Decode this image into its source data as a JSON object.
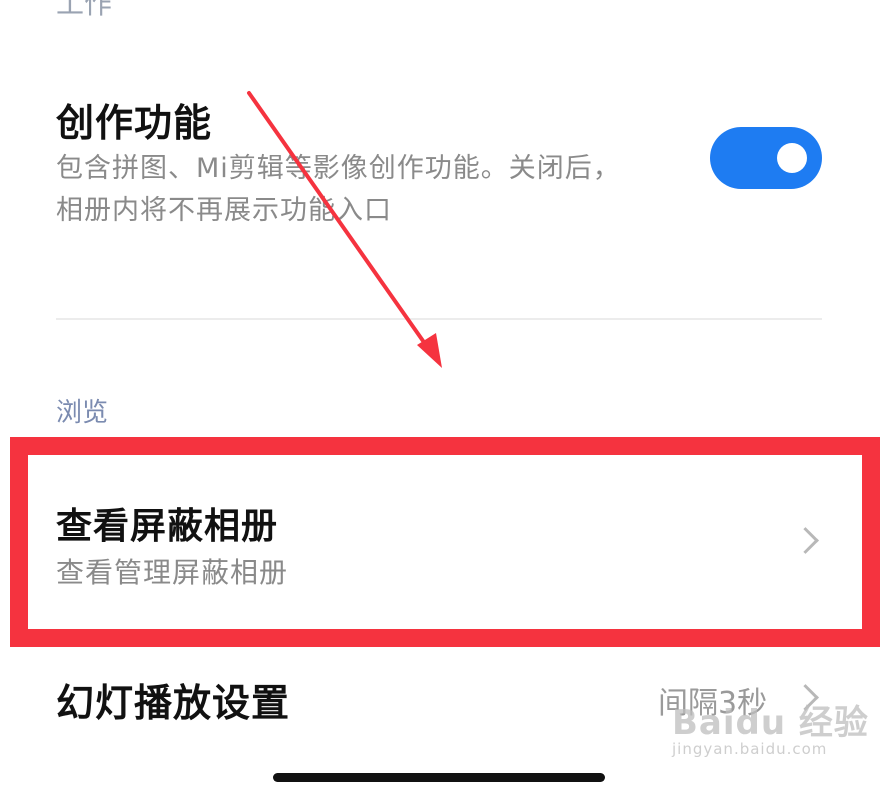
{
  "top_clipped_text": "工作",
  "creative": {
    "title": "创作功能",
    "desc_line1": "包含拼图、Mi剪辑等影像创作功能。关闭后，",
    "desc_line2": "相册内将不再展示功能入口",
    "toggle_on": true
  },
  "browse_section": {
    "header": "浏览"
  },
  "hidden_album": {
    "title": "查看屏蔽相册",
    "subtitle": "查看管理屏蔽相册"
  },
  "slideshow": {
    "title": "幻灯播放设置",
    "value": "间隔3秒"
  },
  "watermark": {
    "main": "Baidu 经验",
    "sub": "jingyan.baidu.com"
  },
  "colors": {
    "toggle": "#1e7cf2",
    "highlight": "#f5333f",
    "annotation_arrow": "#f5333f",
    "section_header": "#7b8bb0"
  }
}
